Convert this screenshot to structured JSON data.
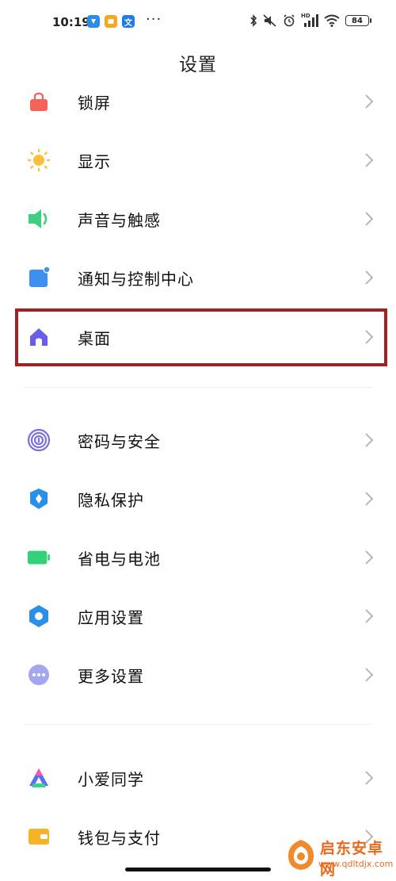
{
  "status_bar": {
    "time": "10:19",
    "dots": "···",
    "battery": "84",
    "notification_icons": [
      "blue-app-icon",
      "yellow-app-icon",
      "translate-icon"
    ],
    "system_icons": [
      "bluetooth-icon",
      "mute-icon",
      "alarm-icon",
      "hd-signal-icon",
      "wifi-icon",
      "battery-icon"
    ],
    "hd_label": "HD"
  },
  "header": {
    "title": "设置"
  },
  "group1": [
    {
      "label": "锁屏",
      "icon": "lock-icon",
      "color": "#f0645a"
    },
    {
      "label": "显示",
      "icon": "sun-icon",
      "color": "#fbbf3a"
    },
    {
      "label": "声音与触感",
      "icon": "speaker-icon",
      "color": "#3fcf83"
    },
    {
      "label": "通知与控制中心",
      "icon": "notification-icon",
      "color": "#3f8ff0"
    },
    {
      "label": "桌面",
      "icon": "home-icon",
      "color": "#6a5ee8"
    }
  ],
  "group2": [
    {
      "label": "密码与安全",
      "icon": "fingerprint-icon",
      "color": "#7b6fe6"
    },
    {
      "label": "隐私保护",
      "icon": "privacy-icon",
      "color": "#2a8fe8"
    },
    {
      "label": "省电与电池",
      "icon": "battery-saver-icon",
      "color": "#34d17b"
    },
    {
      "label": "应用设置",
      "icon": "gear-icon",
      "color": "#2a8fe8"
    },
    {
      "label": "更多设置",
      "icon": "more-icon",
      "color": "#a3a6f0"
    }
  ],
  "group3": [
    {
      "label": "小爱同学",
      "icon": "xiaoai-icon",
      "color": "#5a6ff0"
    },
    {
      "label": "钱包与支付",
      "icon": "wallet-icon",
      "color": "#f6b325"
    }
  ],
  "watermark": {
    "title": "启东安卓网",
    "url": "www.qdltdjx.com"
  }
}
